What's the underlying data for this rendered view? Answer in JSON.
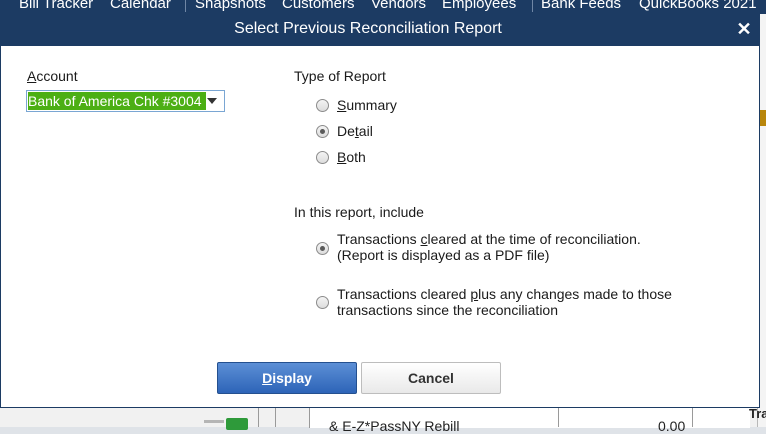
{
  "background": {
    "menu_items": [
      "Bill Tracker",
      "Calendar",
      "Snapshots",
      "Customers",
      "Vendors",
      "Employees",
      "Bank Feeds",
      "QuickBooks 2021"
    ],
    "row_text": "& E-Z*PassNY Rebill",
    "row_amount": "0.00",
    "right_text": "Tra"
  },
  "dialog": {
    "title": "Select Previous Reconciliation Report",
    "close_glyph": "✕",
    "account": {
      "label_first": "A",
      "label_rest": "ccount",
      "value": "Bank of America Chk #3004"
    },
    "report_type": {
      "heading": "Type of Report",
      "options": [
        {
          "mnemonic": "S",
          "rest": "ummary",
          "checked": false
        },
        {
          "pre": "De",
          "mnemonic": "t",
          "rest": "ail",
          "checked": true
        },
        {
          "mnemonic": "B",
          "rest": "oth",
          "checked": false
        }
      ]
    },
    "include": {
      "heading": "In this report, include",
      "options": [
        {
          "line1_pre": "Transactions ",
          "line1_mnemonic": "c",
          "line1_rest": "leared at the time of reconciliation.",
          "line2": "(Report is displayed as a PDF file)",
          "checked": true
        },
        {
          "line1_pre": "Transactions cleared ",
          "line1_mnemonic": "p",
          "line1_rest": "lus any changes made to those",
          "line2": "transactions since the reconciliation",
          "checked": false
        }
      ]
    },
    "buttons": {
      "display_mnemonic": "D",
      "display_rest": "isplay",
      "cancel": "Cancel"
    }
  }
}
